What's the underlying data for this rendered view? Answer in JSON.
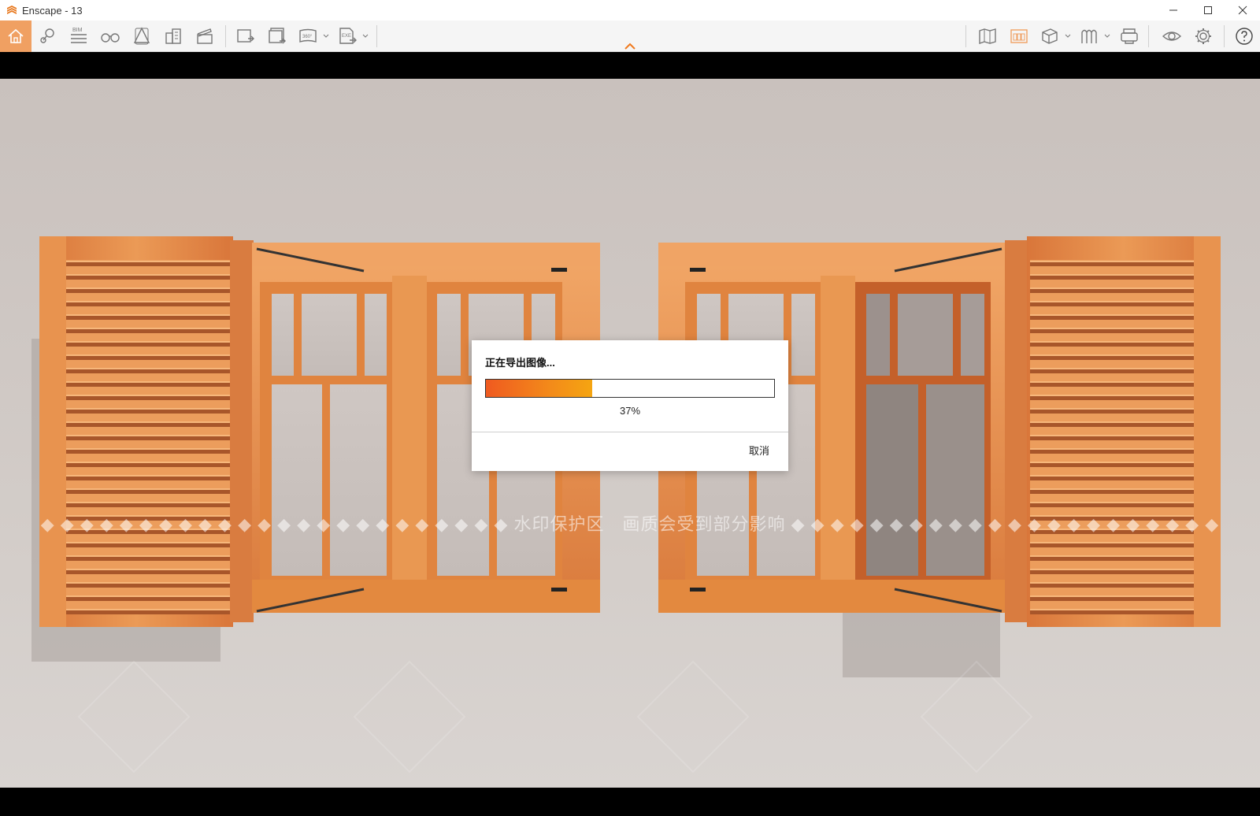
{
  "window": {
    "title": "Enscape - 13",
    "controls": [
      "minimize",
      "maximize",
      "close"
    ]
  },
  "toolbar": {
    "left_icons": [
      "home-icon",
      "map-pin-icon",
      "bim-icon",
      "binoculars-icon",
      "section-icon",
      "building-icon",
      "clapper-icon",
      "screenshot-icon",
      "batch-render-icon",
      "panorama-360-icon",
      "exe-export-icon"
    ],
    "bim_label": "BIM",
    "panorama_label": "360°",
    "exe_label": "EXE",
    "right_icons": [
      "asset-map-icon",
      "asset-library-icon",
      "cube-icon",
      "material-icon",
      "vr-headset-icon",
      "eye-icon",
      "gear-icon",
      "help-icon"
    ]
  },
  "dialog": {
    "title": "正在导出图像...",
    "progress_percent": 37,
    "progress_label": "37%",
    "cancel_label": "取消"
  },
  "viewport": {
    "watermark_text": "◆ ◆ ◆ ◆ ◆ ◆ ◆ ◆ ◆ ◆ ◆ ◆ ◆ ◆ ◆ ◆ ◆ ◆ ◆ ◆ ◆ ◆ ◆ ◆ 水印保护区　画质会受到部分影响 ◆ ◆ ◆ ◆ ◆ ◆ ◆ ◆ ◆ ◆ ◆ ◆ ◆ ◆ ◆ ◆ ◆ ◆ ◆ ◆ ◆ ◆"
  },
  "colors": {
    "accent": "#f07a1e",
    "wood": "#e58a43",
    "wood_dark": "#c8642a",
    "wall": "#cfc8c4"
  }
}
